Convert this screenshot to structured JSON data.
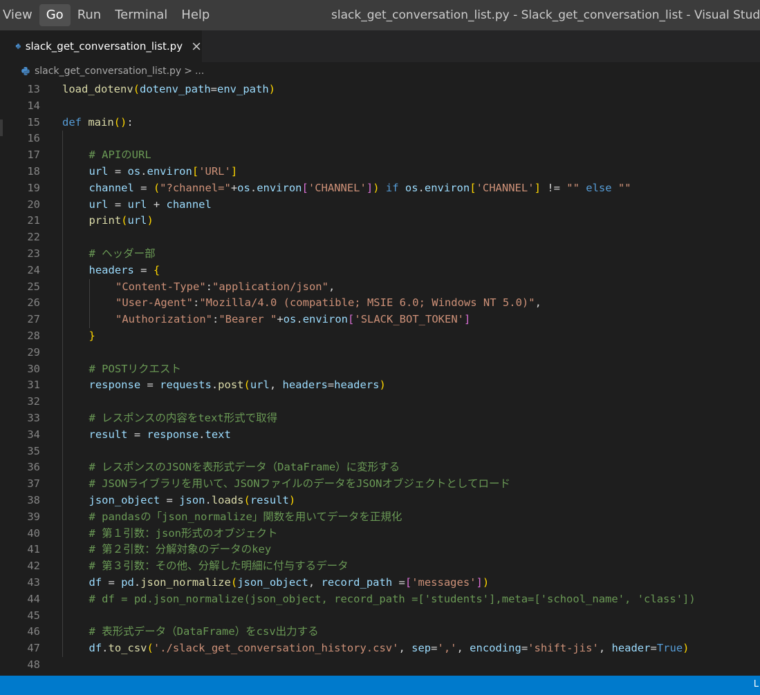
{
  "menu": {
    "items": [
      "View",
      "Go",
      "Run",
      "Terminal",
      "Help"
    ],
    "active": "Go"
  },
  "window_title": "slack_get_conversation_list.py - Slack_get_conversation_list - Visual Studio Code",
  "tab": {
    "label": "slack_get_conversation_list.py",
    "close_icon": "×"
  },
  "breadcrumb": {
    "file": "slack_get_conversation_list.py",
    "separator": ">",
    "more": "..."
  },
  "status_bar": {
    "right_text": "L"
  },
  "editor": {
    "lines": [
      {
        "n": "13",
        "indent": 0,
        "tokens": [
          [
            "fn",
            "load_dotenv"
          ],
          [
            "p1",
            "("
          ],
          [
            "var",
            "dotenv_path"
          ],
          [
            "op",
            "="
          ],
          [
            "var",
            "env_path"
          ],
          [
            "p1",
            ")"
          ]
        ]
      },
      {
        "n": "14",
        "indent": 0,
        "tokens": []
      },
      {
        "n": "15",
        "indent": 0,
        "tokens": [
          [
            "kw",
            "def "
          ],
          [
            "fn",
            "main"
          ],
          [
            "p1",
            "()"
          ],
          [
            "op",
            ":"
          ]
        ]
      },
      {
        "n": "16",
        "indent": 1,
        "tokens": []
      },
      {
        "n": "17",
        "indent": 1,
        "tokens": [
          [
            "cmt",
            "# APIのURL"
          ]
        ]
      },
      {
        "n": "18",
        "indent": 1,
        "tokens": [
          [
            "var",
            "url"
          ],
          [
            "op",
            " = "
          ],
          [
            "var",
            "os"
          ],
          [
            "op",
            "."
          ],
          [
            "var",
            "environ"
          ],
          [
            "p1",
            "["
          ],
          [
            "str",
            "'URL'"
          ],
          [
            "p1",
            "]"
          ]
        ]
      },
      {
        "n": "19",
        "indent": 1,
        "tokens": [
          [
            "var",
            "channel"
          ],
          [
            "op",
            " = "
          ],
          [
            "p1",
            "("
          ],
          [
            "str",
            "\"?channel=\""
          ],
          [
            "op",
            "+"
          ],
          [
            "var",
            "os"
          ],
          [
            "op",
            "."
          ],
          [
            "var",
            "environ"
          ],
          [
            "p2",
            "["
          ],
          [
            "str",
            "'CHANNEL'"
          ],
          [
            "p2",
            "]"
          ],
          [
            "p1",
            ")"
          ],
          [
            "kw",
            " if "
          ],
          [
            "var",
            "os"
          ],
          [
            "op",
            "."
          ],
          [
            "var",
            "environ"
          ],
          [
            "p1",
            "["
          ],
          [
            "str",
            "'CHANNEL'"
          ],
          [
            "p1",
            "]"
          ],
          [
            "op",
            " != "
          ],
          [
            "str",
            "\"\""
          ],
          [
            "kw",
            " else "
          ],
          [
            "str",
            "\"\""
          ]
        ]
      },
      {
        "n": "20",
        "indent": 1,
        "tokens": [
          [
            "var",
            "url"
          ],
          [
            "op",
            " = "
          ],
          [
            "var",
            "url"
          ],
          [
            "op",
            " + "
          ],
          [
            "var",
            "channel"
          ]
        ]
      },
      {
        "n": "21",
        "indent": 1,
        "tokens": [
          [
            "fn",
            "print"
          ],
          [
            "p1",
            "("
          ],
          [
            "var",
            "url"
          ],
          [
            "p1",
            ")"
          ]
        ]
      },
      {
        "n": "22",
        "indent": 1,
        "tokens": []
      },
      {
        "n": "23",
        "indent": 1,
        "tokens": [
          [
            "cmt",
            "# ヘッダー部"
          ]
        ]
      },
      {
        "n": "24",
        "indent": 1,
        "tokens": [
          [
            "var",
            "headers"
          ],
          [
            "op",
            " = "
          ],
          [
            "p1",
            "{"
          ]
        ]
      },
      {
        "n": "25",
        "indent": 2,
        "tokens": [
          [
            "str",
            "\"Content-Type\""
          ],
          [
            "op",
            ":"
          ],
          [
            "str",
            "\"application/json\""
          ],
          [
            "op",
            ","
          ]
        ]
      },
      {
        "n": "26",
        "indent": 2,
        "tokens": [
          [
            "str",
            "\"User-Agent\""
          ],
          [
            "op",
            ":"
          ],
          [
            "str",
            "\"Mozilla/4.0 (compatible; MSIE 6.0; Windows NT 5.0)\""
          ],
          [
            "op",
            ","
          ]
        ]
      },
      {
        "n": "27",
        "indent": 2,
        "tokens": [
          [
            "str",
            "\"Authorization\""
          ],
          [
            "op",
            ":"
          ],
          [
            "str",
            "\"Bearer \""
          ],
          [
            "op",
            "+"
          ],
          [
            "var",
            "os"
          ],
          [
            "op",
            "."
          ],
          [
            "var",
            "environ"
          ],
          [
            "p2",
            "["
          ],
          [
            "str",
            "'SLACK_BOT_TOKEN'"
          ],
          [
            "p2",
            "]"
          ]
        ]
      },
      {
        "n": "28",
        "indent": 1,
        "tokens": [
          [
            "p1",
            "}"
          ]
        ]
      },
      {
        "n": "29",
        "indent": 1,
        "tokens": []
      },
      {
        "n": "30",
        "indent": 1,
        "tokens": [
          [
            "cmt",
            "# POSTリクエスト"
          ]
        ]
      },
      {
        "n": "31",
        "indent": 1,
        "tokens": [
          [
            "var",
            "response"
          ],
          [
            "op",
            " = "
          ],
          [
            "var",
            "requests"
          ],
          [
            "op",
            "."
          ],
          [
            "fn",
            "post"
          ],
          [
            "p1",
            "("
          ],
          [
            "var",
            "url"
          ],
          [
            "op",
            ", "
          ],
          [
            "var",
            "headers"
          ],
          [
            "op",
            "="
          ],
          [
            "var",
            "headers"
          ],
          [
            "p1",
            ")"
          ]
        ]
      },
      {
        "n": "32",
        "indent": 1,
        "tokens": []
      },
      {
        "n": "33",
        "indent": 1,
        "tokens": [
          [
            "cmt",
            "# レスポンスの内容をtext形式で取得"
          ]
        ]
      },
      {
        "n": "34",
        "indent": 1,
        "tokens": [
          [
            "var",
            "result"
          ],
          [
            "op",
            " = "
          ],
          [
            "var",
            "response"
          ],
          [
            "op",
            "."
          ],
          [
            "var",
            "text"
          ]
        ]
      },
      {
        "n": "35",
        "indent": 1,
        "tokens": []
      },
      {
        "n": "36",
        "indent": 1,
        "tokens": [
          [
            "cmt",
            "# レスポンスのJSONを表形式データ（DataFrame）に変形する"
          ]
        ]
      },
      {
        "n": "37",
        "indent": 1,
        "tokens": [
          [
            "cmt",
            "# JSONライブラリを用いて、JSONファイルのデータをJSONオブジェクトとしてロード"
          ]
        ]
      },
      {
        "n": "38",
        "indent": 1,
        "tokens": [
          [
            "var",
            "json_object"
          ],
          [
            "op",
            " = "
          ],
          [
            "var",
            "json"
          ],
          [
            "op",
            "."
          ],
          [
            "fn",
            "loads"
          ],
          [
            "p1",
            "("
          ],
          [
            "var",
            "result"
          ],
          [
            "p1",
            ")"
          ]
        ]
      },
      {
        "n": "39",
        "indent": 1,
        "tokens": [
          [
            "cmt",
            "# pandasの「json_normalize」関数を用いてデータを正規化"
          ]
        ]
      },
      {
        "n": "40",
        "indent": 1,
        "tokens": [
          [
            "cmt",
            "# 第１引数：json形式のオブジェクト"
          ]
        ]
      },
      {
        "n": "41",
        "indent": 1,
        "tokens": [
          [
            "cmt",
            "# 第２引数：分解対象のデータのkey"
          ]
        ]
      },
      {
        "n": "42",
        "indent": 1,
        "tokens": [
          [
            "cmt",
            "# 第３引数：その他、分解した明細に付与するデータ"
          ]
        ]
      },
      {
        "n": "43",
        "indent": 1,
        "tokens": [
          [
            "var",
            "df"
          ],
          [
            "op",
            " = "
          ],
          [
            "var",
            "pd"
          ],
          [
            "op",
            "."
          ],
          [
            "fn",
            "json_normalize"
          ],
          [
            "p1",
            "("
          ],
          [
            "var",
            "json_object"
          ],
          [
            "op",
            ", "
          ],
          [
            "var",
            "record_path"
          ],
          [
            "op",
            " ="
          ],
          [
            "p2",
            "["
          ],
          [
            "str",
            "'messages'"
          ],
          [
            "p2",
            "]"
          ],
          [
            "p1",
            ")"
          ]
        ]
      },
      {
        "n": "44",
        "indent": 1,
        "tokens": [
          [
            "cmt",
            "# df = pd.json_normalize(json_object, record_path =['students'],meta=['school_name', 'class'])"
          ]
        ]
      },
      {
        "n": "45",
        "indent": 1,
        "tokens": []
      },
      {
        "n": "46",
        "indent": 1,
        "tokens": [
          [
            "cmt",
            "# 表形式データ（DataFrame）をcsv出力する"
          ]
        ]
      },
      {
        "n": "47",
        "indent": 1,
        "tokens": [
          [
            "var",
            "df"
          ],
          [
            "op",
            "."
          ],
          [
            "fn",
            "to_csv"
          ],
          [
            "p1",
            "("
          ],
          [
            "str",
            "'./slack_get_conversation_history.csv'"
          ],
          [
            "op",
            ", "
          ],
          [
            "var",
            "sep"
          ],
          [
            "op",
            "="
          ],
          [
            "str",
            "','"
          ],
          [
            "op",
            ", "
          ],
          [
            "var",
            "encoding"
          ],
          [
            "op",
            "="
          ],
          [
            "str",
            "'shift-jis'"
          ],
          [
            "op",
            ", "
          ],
          [
            "var",
            "header"
          ],
          [
            "op",
            "="
          ],
          [
            "kw",
            "True"
          ],
          [
            "p1",
            ")"
          ]
        ]
      },
      {
        "n": "48",
        "indent": 0,
        "tokens": []
      }
    ]
  }
}
